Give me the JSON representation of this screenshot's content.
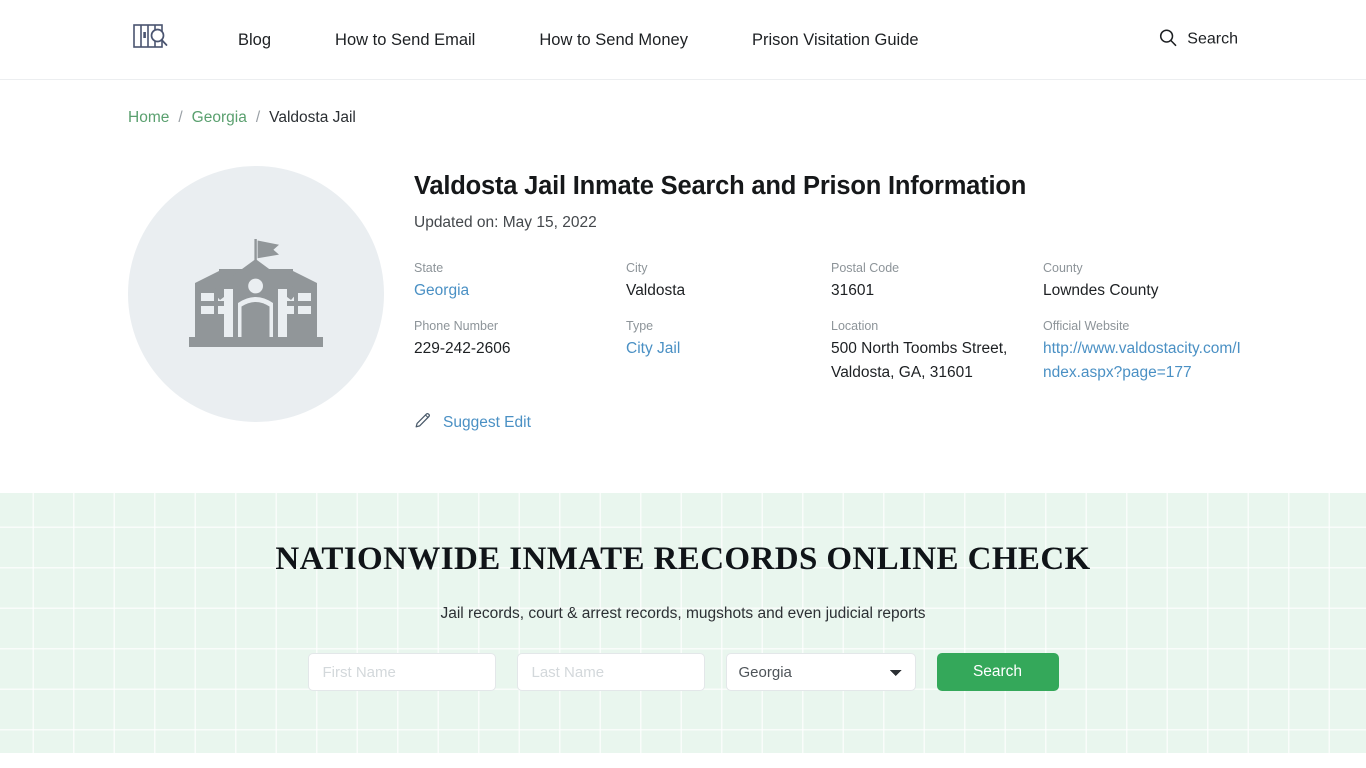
{
  "header": {
    "logo_name": "prison-bars-search-logo",
    "nav": [
      {
        "label": "Blog"
      },
      {
        "label": "How to Send Email"
      },
      {
        "label": "How to Send Money"
      },
      {
        "label": "Prison Visitation Guide"
      }
    ],
    "search_label": "Search",
    "search_icon": "search-icon"
  },
  "breadcrumb": {
    "home": "Home",
    "state": "Georgia",
    "current": "Valdosta Jail",
    "separator": "/"
  },
  "jail": {
    "thumbnail_icon": "institutional-building-icon",
    "title": "Valdosta Jail Inmate Search and Prison Information",
    "updated": "Updated on: May 15, 2022",
    "facts": [
      {
        "label": "State",
        "value": "Georgia",
        "is_link": true
      },
      {
        "label": "City",
        "value": "Valdosta",
        "is_link": false
      },
      {
        "label": "Postal Code",
        "value": "31601",
        "is_link": false
      },
      {
        "label": "County",
        "value": "Lowndes County",
        "is_link": false
      },
      {
        "label": "Phone Number",
        "value": "229-242-2606",
        "is_link": false
      },
      {
        "label": "Type",
        "value": "City Jail",
        "is_link": true
      },
      {
        "label": "Location",
        "value": "500 North Toombs Street, Valdosta, GA, 31601",
        "is_link": false
      },
      {
        "label": "Official Website",
        "value": "http://www.valdostacity.com/Index.aspx?page=177",
        "is_link": true
      }
    ],
    "suggest_edit_label": "Suggest Edit",
    "suggest_edit_icon": "pencil-icon"
  },
  "records": {
    "title": "NATIONWIDE INMATE RECORDS ONLINE CHECK",
    "subtitle": "Jail records, court & arrest records, mugshots and even judicial reports",
    "first_name_placeholder": "First Name",
    "first_name_value": "",
    "last_name_placeholder": "Last Name",
    "last_name_value": "",
    "state_selected": "Georgia",
    "state_options": [
      "Georgia"
    ],
    "search_button": "Search"
  },
  "colors": {
    "accent_green": "#34a85a",
    "band_background": "#e9f6ee",
    "link_blue": "#4a90c4",
    "breadcrumb_green": "#5aa06f"
  }
}
